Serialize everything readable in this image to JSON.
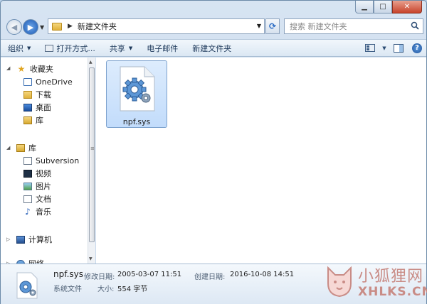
{
  "window": {
    "caption": {
      "minimize": "▁",
      "maximize": "□",
      "close": "✕"
    }
  },
  "address": {
    "path": [
      "新建文件夹"
    ],
    "search_placeholder": "搜索 新建文件夹"
  },
  "toolbar": {
    "organize": "组织",
    "open_with": "打开方式...",
    "share": "共享",
    "email": "电子邮件",
    "new_folder": "新建文件夹",
    "help": "?"
  },
  "nav": {
    "favorites": {
      "label": "收藏夹",
      "items": [
        "OneDrive",
        "下载",
        "桌面",
        "库"
      ]
    },
    "libraries": {
      "label": "库",
      "items": [
        "Subversion",
        "视频",
        "图片",
        "文档",
        "音乐"
      ]
    },
    "computer": {
      "label": "计算机"
    },
    "network": {
      "label": "网络"
    }
  },
  "files": [
    {
      "name": "npf.sys",
      "icon": "system-file-gear-icon"
    }
  ],
  "details": {
    "name": "npf.sys",
    "type": "系统文件",
    "modified_label": "修改日期:",
    "modified_value": "2005-03-07 11:51",
    "created_label": "创建日期:",
    "created_value": "2016-10-08 14:51",
    "size_label": "大小:",
    "size_value": "554 字节"
  },
  "watermark": {
    "cn": "小狐狸网",
    "en": "XHLKS.CN"
  },
  "colors": {
    "accent": "#1b58b4",
    "selection": "#c2dcfb",
    "watermark": "#c98c86"
  }
}
